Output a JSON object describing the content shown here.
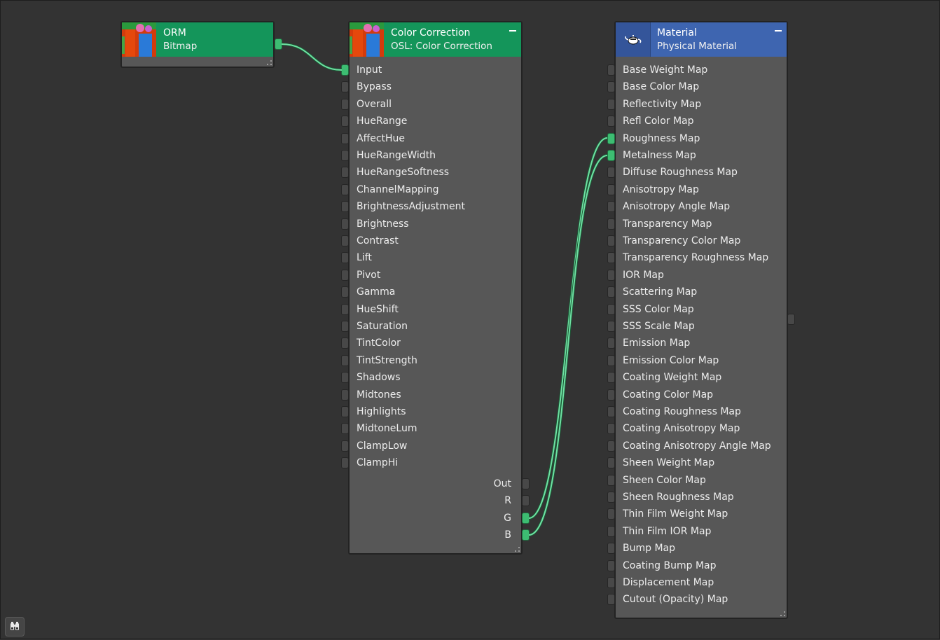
{
  "nodes": {
    "orm": {
      "title": "ORM",
      "subtitle": "Bitmap",
      "header_color": "#14955a",
      "thumbnail": "bitmap-thumbnail"
    },
    "cc": {
      "title": "Color Correction",
      "subtitle": "OSL: Color Correction",
      "header_color": "#14955a",
      "thumbnail": "bitmap-thumbnail",
      "inputs": [
        "Input",
        "Bypass",
        "Overall",
        "HueRange",
        "AffectHue",
        "HueRangeWidth",
        "HueRangeSoftness",
        "ChannelMapping",
        "BrightnessAdjustment",
        "Brightness",
        "Contrast",
        "Lift",
        "Pivot",
        "Gamma",
        "HueShift",
        "Saturation",
        "TintColor",
        "TintStrength",
        "Shadows",
        "Midtones",
        "Highlights",
        "MidtoneLum",
        "ClampLow",
        "ClampHi"
      ],
      "connected_inputs": [
        0
      ],
      "outputs": [
        "Out",
        "R",
        "G",
        "B"
      ],
      "connected_outputs": [
        2,
        3
      ]
    },
    "mat": {
      "title": "Material",
      "subtitle": "Physical Material",
      "header_color": "#3e65b0",
      "thumbnail": "teapot-icon",
      "inputs": [
        "Base Weight Map",
        "Base Color Map",
        "Reflectivity Map",
        "Refl Color Map",
        "Roughness Map",
        "Metalness Map",
        "Diffuse Roughness Map",
        "Anisotropy Map",
        "Anisotropy Angle Map",
        "Transparency Map",
        "Transparency Color Map",
        "Transparency Roughness Map",
        "IOR Map",
        "Scattering Map",
        "SSS Color Map",
        "SSS Scale Map",
        "Emission Map",
        "Emission Color Map",
        "Coating Weight Map",
        "Coating Color Map",
        "Coating Roughness Map",
        "Coating Anisotropy Map",
        "Coating Anisotropy Angle Map",
        "Sheen Weight Map",
        "Sheen Color Map",
        "Sheen Roughness Map",
        "Thin Film Weight Map",
        "Thin Film IOR Map",
        "Bump Map",
        "Coating Bump Map",
        "Displacement Map",
        "Cutout (Opacity) Map"
      ],
      "connected_inputs": [
        4,
        5
      ]
    }
  },
  "connections": [
    {
      "from": "orm.out",
      "to": "cc.Input"
    },
    {
      "from": "cc.G",
      "to": "mat.Roughness Map"
    },
    {
      "from": "cc.B",
      "to": "mat.Metalness Map"
    }
  ],
  "colors": {
    "canvas": "#333333",
    "node_body": "#575757",
    "green_header": "#14955a",
    "blue_header": "#3e65b0",
    "wire": "#6fe0a3",
    "port_connected": "#3dbd72"
  },
  "toolbar": {
    "bottom_left_button_icon": "binoculars-icon"
  }
}
